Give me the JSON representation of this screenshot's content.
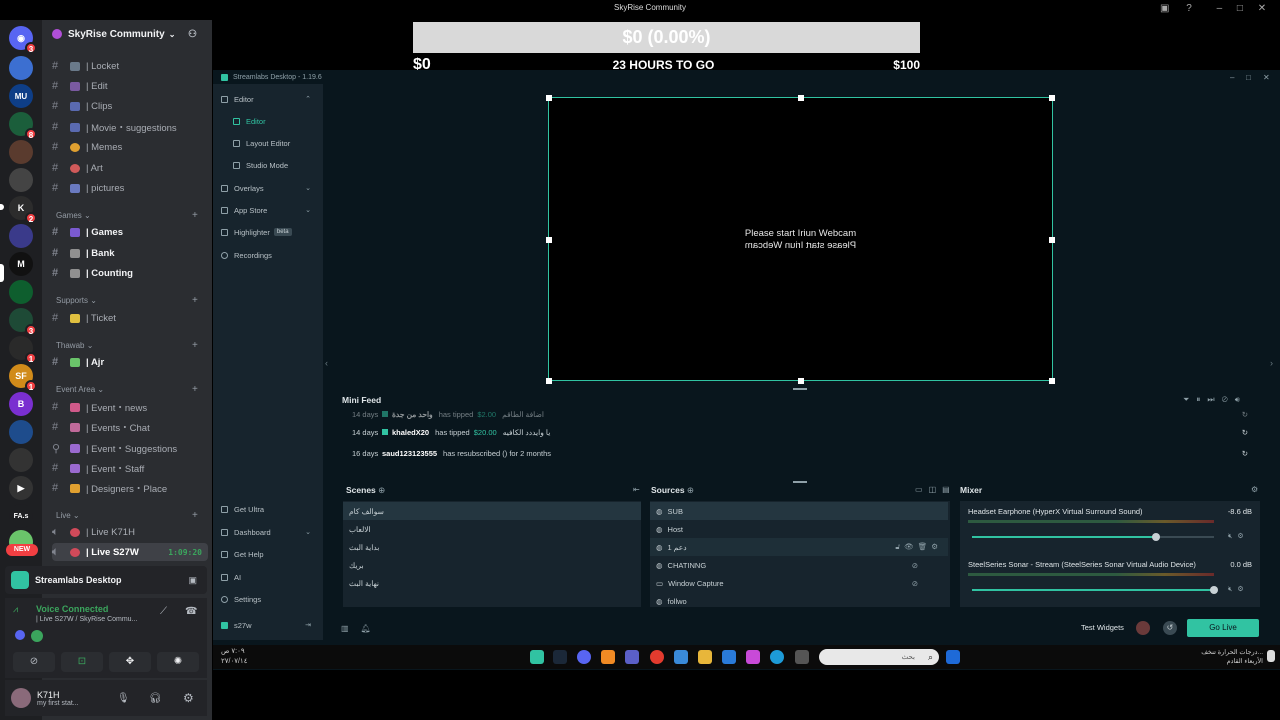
{
  "top_overlay": {
    "title_text": "SkyRise Community",
    "goal_percent_text": "$0 (0.00%)",
    "goal_start": "$0",
    "goal_end": "$100",
    "goal_time": "23 HOURS TO GO",
    "goal_progress": 0
  },
  "discord": {
    "guild_name": "SkyRise Community",
    "guild_icon": "chevron-down-icon",
    "categories": [
      {
        "label": "Games"
      },
      {
        "label": "Supports"
      },
      {
        "label": "Thawab"
      },
      {
        "label": "Event Area"
      },
      {
        "label": "Live"
      }
    ],
    "channels": [
      {
        "label": "| Locket"
      },
      {
        "label": "| Edit"
      },
      {
        "label": "| Clips"
      },
      {
        "label": "| Movie・suggestions"
      },
      {
        "label": "| Memes"
      },
      {
        "label": "| Art"
      },
      {
        "label": "| pictures"
      },
      {
        "label": "| Games"
      },
      {
        "label": "| Bank"
      },
      {
        "label": "| Counting"
      },
      {
        "label": "| Ticket"
      },
      {
        "label": "| Ajr"
      },
      {
        "label": "| Event・news"
      },
      {
        "label": "| Events・Chat"
      },
      {
        "label": "| Event・Suggestions"
      },
      {
        "label": "| Event・Staff"
      },
      {
        "label": "| Designers・Place"
      },
      {
        "label": "| Live K71H"
      },
      {
        "label": "| Live S27W"
      }
    ],
    "live_timer": "1:09:20",
    "activity_name": "Streamlabs Desktop",
    "voice_status": "Voice Connected",
    "voice_channel": "| Live S27W / SkyRise Commu...",
    "username": "K71H",
    "user_status": "my first stat...",
    "rail_badges": [
      "3",
      "8",
      "2",
      "3",
      "1",
      "1",
      "6"
    ],
    "rail_new": "NEW",
    "rail_text_icons": [
      "FA.s"
    ],
    "colors": {
      "rail_bg": "#1e1f22",
      "channel_bg": "#2b2d31",
      "voice_green": "#3ba55d",
      "badge_red": "#f23f42"
    }
  },
  "streamlabs": {
    "window_title": "Streamlabs Desktop - 1.19.6",
    "nav": [
      {
        "label": "Editor",
        "icon": "editor-icon"
      },
      {
        "label": "Editor",
        "icon": "editor-sub-icon"
      },
      {
        "label": "Layout Editor",
        "icon": "layout-icon"
      },
      {
        "label": "Studio Mode",
        "icon": "studio-icon"
      },
      {
        "label": "Overlays",
        "icon": "overlays-icon"
      },
      {
        "label": "App Store",
        "icon": "store-icon"
      },
      {
        "label": "Highlighter",
        "icon": "highlighter-icon"
      },
      {
        "label": "Recordings",
        "icon": "recordings-icon"
      }
    ],
    "beta_label": "beta",
    "bottom_nav": [
      {
        "label": "Get Ultra"
      },
      {
        "label": "Dashboard"
      },
      {
        "label": "Get Help"
      },
      {
        "label": "AI"
      },
      {
        "label": "Settings"
      },
      {
        "label": "s27w"
      }
    ],
    "preview_text_1": "Please start Iriun Webcam",
    "preview_text_2": "Please start Iriun Webcam",
    "mini_feed_title": "Mini Feed",
    "feed": [
      {
        "age": "14 days",
        "user": "واحد من جدة",
        "action": "has tipped",
        "amount": "$2.00",
        "msg": "اضافة الطاقم"
      },
      {
        "age": "14 days",
        "user": "khaledX20",
        "action": "has tipped",
        "amount": "$20.00",
        "msg": "يا وايددد الكافيه"
      },
      {
        "age": "16 days",
        "user": "saud123123555",
        "action": "has resubscribed () for 2 months",
        "amount": "",
        "msg": ""
      }
    ],
    "scenes_title": "Scenes",
    "scenes": [
      "سوالف كام",
      "الالعاب",
      "بداية البث",
      "بريك",
      "نهاية البث"
    ],
    "sources_title": "Sources",
    "sources": [
      "SUB",
      "Host",
      "دعم 1",
      "CHATINNG",
      "Window Capture",
      "follwo"
    ],
    "mixer_title": "Mixer",
    "mixer": [
      {
        "name": "Headset Earphone (HyperX Virtual Surround Sound)",
        "db": "-8.6 dB",
        "level": 0.76
      },
      {
        "name": "SteelSeries Sonar - Stream (SteelSeries Sonar Virtual Audio Device)",
        "db": "0.0 dB",
        "level": 1.0
      }
    ],
    "test_widgets": "Test Widgets",
    "go_live": "Go Live",
    "colors": {
      "accent": "#31c3a2",
      "bg": "#09161d",
      "panel": "#17242d"
    }
  },
  "taskbar": {
    "search_placeholder": "بحث",
    "clock_time": "٧:٠٩ ص",
    "clock_date": "٢٧/٠٧/١٤",
    "weather_text": "درجات الحرارة تنخف...",
    "weather_sub": "الأربعاء القادم"
  }
}
